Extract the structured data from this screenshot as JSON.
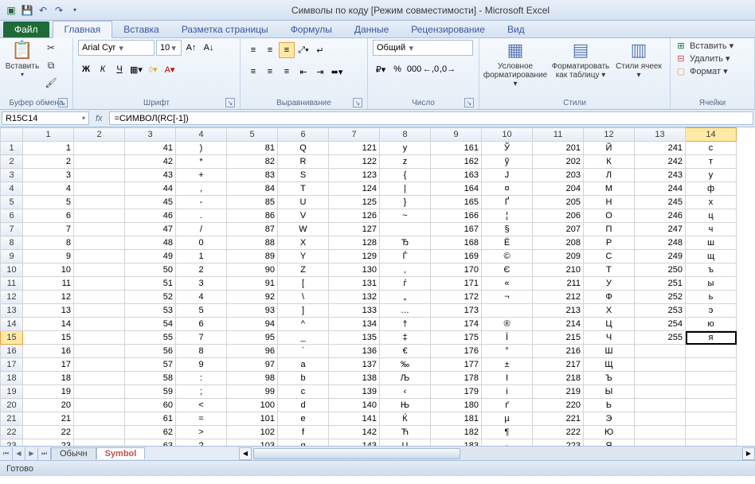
{
  "app": {
    "title": "Символы по коду  [Режим совместимости]  -  Microsoft Excel"
  },
  "tabs": {
    "file": "Файл",
    "items": [
      "Главная",
      "Вставка",
      "Разметка страницы",
      "Формулы",
      "Данные",
      "Рецензирование",
      "Вид"
    ],
    "active": 0
  },
  "ribbon": {
    "clipboard": {
      "label": "Буфер обмена",
      "paste": "Вставить"
    },
    "font": {
      "label": "Шрифт",
      "name": "Arial Cyr",
      "size": "10"
    },
    "alignment": {
      "label": "Выравнивание"
    },
    "number": {
      "label": "Число",
      "format": "Общий"
    },
    "styles": {
      "label": "Стили",
      "cond": "Условное форматирование ▾",
      "table": "Форматировать как таблицу ▾",
      "cell": "Стили ячеек ▾"
    },
    "cells": {
      "label": "Ячейки",
      "insert": "Вставить ▾",
      "delete": "Удалить ▾",
      "format": "Формат ▾"
    }
  },
  "formula": {
    "name_box": "R15C14",
    "fx": "fx",
    "value": "=СИМВОЛ(RC[-1])"
  },
  "columns": [
    "1",
    "2",
    "3",
    "4",
    "5",
    "6",
    "7",
    "8",
    "9",
    "10",
    "11",
    "12",
    "13",
    "14"
  ],
  "active_cell": {
    "row": 15,
    "col": 14
  },
  "rows": [
    {
      "h": "1",
      "c": [
        "1",
        "",
        "41",
        ")",
        "81",
        "Q",
        "121",
        "y",
        "161",
        "Ў",
        "201",
        "Й",
        "241",
        "с"
      ]
    },
    {
      "h": "2",
      "c": [
        "2",
        "",
        "42",
        "*",
        "82",
        "R",
        "122",
        "z",
        "162",
        "ў",
        "202",
        "К",
        "242",
        "т"
      ]
    },
    {
      "h": "3",
      "c": [
        "3",
        "",
        "43",
        "+",
        "83",
        "S",
        "123",
        "{",
        "163",
        "Ј",
        "203",
        "Л",
        "243",
        "у"
      ]
    },
    {
      "h": "4",
      "c": [
        "4",
        "",
        "44",
        ",",
        "84",
        "T",
        "124",
        "|",
        "164",
        "¤",
        "204",
        "М",
        "244",
        "ф"
      ]
    },
    {
      "h": "5",
      "c": [
        "5",
        "",
        "45",
        "-",
        "85",
        "U",
        "125",
        "}",
        "165",
        "Ґ",
        "205",
        "Н",
        "245",
        "х"
      ]
    },
    {
      "h": "6",
      "c": [
        "6",
        "",
        "46",
        ".",
        "86",
        "V",
        "126",
        "~",
        "166",
        "¦",
        "206",
        "О",
        "246",
        "ц"
      ]
    },
    {
      "h": "7",
      "c": [
        "7",
        "",
        "47",
        "/",
        "87",
        "W",
        "127",
        "",
        "167",
        "§",
        "207",
        "П",
        "247",
        "ч"
      ]
    },
    {
      "h": "8",
      "c": [
        "8",
        "",
        "48",
        "0",
        "88",
        "X",
        "128",
        "Ђ",
        "168",
        "Ё",
        "208",
        "Р",
        "248",
        "ш"
      ]
    },
    {
      "h": "9",
      "c": [
        "9",
        "",
        "49",
        "1",
        "89",
        "Y",
        "129",
        "Ѓ",
        "169",
        "©",
        "209",
        "С",
        "249",
        "щ"
      ]
    },
    {
      "h": "10",
      "c": [
        "10",
        "",
        "50",
        "2",
        "90",
        "Z",
        "130",
        "‚",
        "170",
        "Є",
        "210",
        "Т",
        "250",
        "ъ"
      ]
    },
    {
      "h": "11",
      "c": [
        "11",
        "",
        "51",
        "3",
        "91",
        "[",
        "131",
        "ѓ",
        "171",
        "«",
        "211",
        "У",
        "251",
        "ы"
      ]
    },
    {
      "h": "12",
      "c": [
        "12",
        "",
        "52",
        "4",
        "92",
        "\\",
        "132",
        "„",
        "172",
        "¬",
        "212",
        "Ф",
        "252",
        "ь"
      ]
    },
    {
      "h": "13",
      "c": [
        "13",
        "",
        "53",
        "5",
        "93",
        "]",
        "133",
        "…",
        "173",
        "­",
        "213",
        "Х",
        "253",
        "э"
      ]
    },
    {
      "h": "14",
      "c": [
        "14",
        "",
        "54",
        "6",
        "94",
        "^",
        "134",
        "†",
        "174",
        "®",
        "214",
        "Ц",
        "254",
        "ю"
      ]
    },
    {
      "h": "15",
      "c": [
        "15",
        "",
        "55",
        "7",
        "95",
        "_",
        "135",
        "‡",
        "175",
        "Ї",
        "215",
        "Ч",
        "255",
        "я"
      ]
    },
    {
      "h": "16",
      "c": [
        "16",
        "",
        "56",
        "8",
        "96",
        "`",
        "136",
        "€",
        "176",
        "°",
        "216",
        "Ш",
        "",
        ""
      ]
    },
    {
      "h": "17",
      "c": [
        "17",
        "",
        "57",
        "9",
        "97",
        "a",
        "137",
        "‰",
        "177",
        "±",
        "217",
        "Щ",
        "",
        ""
      ]
    },
    {
      "h": "18",
      "c": [
        "18",
        "",
        "58",
        ":",
        "98",
        "b",
        "138",
        "Љ",
        "178",
        "І",
        "218",
        "Ъ",
        "",
        ""
      ]
    },
    {
      "h": "19",
      "c": [
        "19",
        "",
        "59",
        ";",
        "99",
        "c",
        "139",
        "‹",
        "179",
        "і",
        "219",
        "Ы",
        "",
        ""
      ]
    },
    {
      "h": "20",
      "c": [
        "20",
        "",
        "60",
        "<",
        "100",
        "d",
        "140",
        "Њ",
        "180",
        "ґ",
        "220",
        "Ь",
        "",
        ""
      ]
    },
    {
      "h": "21",
      "c": [
        "21",
        "",
        "61",
        "=",
        "101",
        "e",
        "141",
        "Ќ",
        "181",
        "µ",
        "221",
        "Э",
        "",
        ""
      ]
    },
    {
      "h": "22",
      "c": [
        "22",
        "",
        "62",
        ">",
        "102",
        "f",
        "142",
        "Ћ",
        "182",
        "¶",
        "222",
        "Ю",
        "",
        ""
      ]
    },
    {
      "h": "23",
      "c": [
        "23",
        "",
        "63",
        "?",
        "103",
        "g",
        "143",
        "Џ",
        "183",
        "·",
        "223",
        "Я",
        "",
        ""
      ]
    }
  ],
  "sheets": {
    "tabs": [
      "Обычн",
      "Symbol"
    ],
    "active": 1
  },
  "status": {
    "ready": "Готово"
  }
}
